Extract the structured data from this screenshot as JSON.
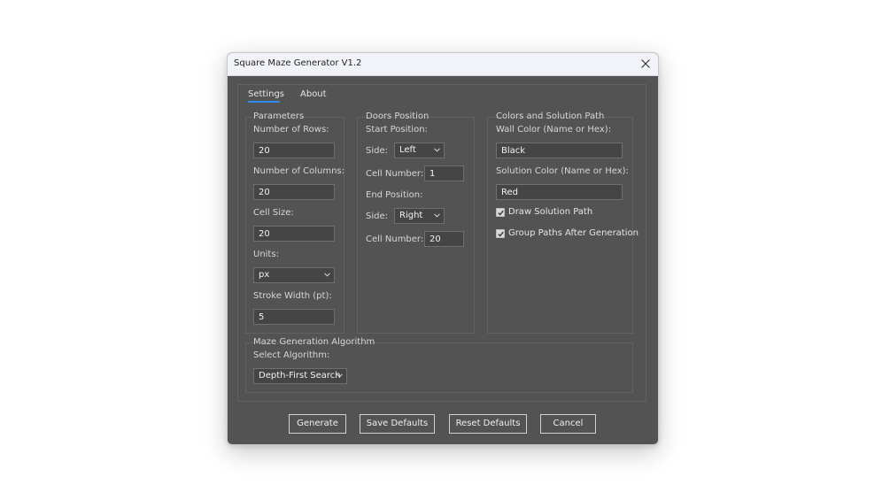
{
  "window": {
    "title": "Square Maze Generator V1.2"
  },
  "tabs": [
    {
      "label": "Settings",
      "active": true
    },
    {
      "label": "About",
      "active": false
    }
  ],
  "parameters": {
    "title": "Parameters",
    "rows_label": "Number of Rows:",
    "rows_value": "20",
    "cols_label": "Number of Columns:",
    "cols_value": "20",
    "cell_size_label": "Cell Size:",
    "cell_size_value": "20",
    "units_label": "Units:",
    "units_value": "px",
    "stroke_label": "Stroke Width (pt):",
    "stroke_value": "5"
  },
  "doors": {
    "title": "Doors Position",
    "start_label": "Start Position:",
    "start_side_label": "Side:",
    "start_side_value": "Left",
    "start_cell_label": "Cell Number:",
    "start_cell_value": "1",
    "end_label": "End Position:",
    "end_side_label": "Side:",
    "end_side_value": "Right",
    "end_cell_label": "Cell Number:",
    "end_cell_value": "20"
  },
  "colors": {
    "title": "Colors and Solution Path",
    "wall_label": "Wall Color (Name or Hex):",
    "wall_value": "Black",
    "solution_label": "Solution Color (Name or Hex):",
    "solution_value": "Red",
    "draw_path_label": "Draw Solution Path",
    "draw_path_checked": true,
    "group_paths_label": "Group Paths After Generation",
    "group_paths_checked": true
  },
  "algorithm": {
    "title": "Maze Generation Algorithm",
    "select_label": "Select Algorithm:",
    "value": "Depth-First Search"
  },
  "buttons": {
    "generate": "Generate",
    "save_defaults": "Save Defaults",
    "reset_defaults": "Reset Defaults",
    "cancel": "Cancel"
  },
  "theme": {
    "dialog_bg": "#535353",
    "titlebar_bg": "#f1f3f9",
    "accent": "#2d8cf0",
    "field_bg": "#454545"
  },
  "icons": {
    "close": "close-icon",
    "dropdown": "chevron-down-icon",
    "check": "checkmark-icon"
  }
}
